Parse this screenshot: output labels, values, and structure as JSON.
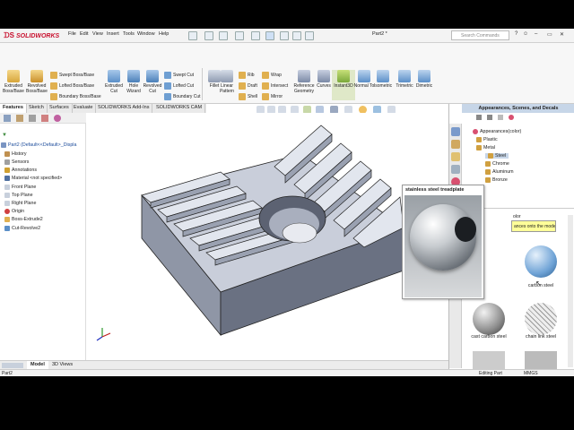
{
  "app": {
    "brand": "SOLIDWORKS",
    "document_title": "Part2 *",
    "search_placeholder": "Search Commands"
  },
  "menu": [
    "File",
    "Edit",
    "View",
    "Insert",
    "Tools",
    "Window",
    "Help"
  ],
  "ribbon": {
    "big_buttons": [
      {
        "label": "Extruded Boss/Base",
        "icon": "extrude-icon"
      },
      {
        "label": "Revolved Boss/Base",
        "icon": "revolve-icon"
      },
      {
        "label": "Extruded Cut",
        "icon": "extruded-cut-icon"
      },
      {
        "label": "Hole Wizard",
        "icon": "hole-wizard-icon"
      },
      {
        "label": "Revolved Cut",
        "icon": "revolved-cut-icon"
      },
      {
        "label": "Fillet",
        "icon": "fillet-icon"
      },
      {
        "label": "Linear Pattern",
        "icon": "linear-pattern-icon"
      },
      {
        "label": "Reference Geometry",
        "icon": "reference-geometry-icon"
      },
      {
        "label": "Curves",
        "icon": "curves-icon"
      },
      {
        "label": "Instant3D",
        "icon": "instant3d-icon"
      },
      {
        "label": "Normal To",
        "icon": "normal-to-icon"
      },
      {
        "label": "Isometric",
        "icon": "isometric-icon"
      },
      {
        "label": "Trimetric",
        "icon": "trimetric-icon"
      },
      {
        "label": "Dimetric",
        "icon": "dimetric-icon"
      }
    ],
    "small_boss": [
      "Swept Boss/Base",
      "Lofted Boss/Base",
      "Boundary Boss/Base"
    ],
    "small_cut": [
      "Swept Cut",
      "Lofted Cut",
      "Boundary Cut"
    ],
    "small_features": [
      "Rib",
      "Draft",
      "Shell"
    ],
    "small_features2": [
      "Wrap",
      "Intersect",
      "Mirror"
    ]
  },
  "tabs": [
    "Features",
    "Sketch",
    "Surfaces",
    "Evaluate",
    "SOLIDWORKS Add-Ins",
    "SOLIDWORKS CAM"
  ],
  "feature_tree": {
    "root": "Part2  (Default<<Default>_Displa",
    "items": [
      "History",
      "Sensors",
      "Annotations",
      "Material <not specified>",
      "Front Plane",
      "Top Plane",
      "Right Plane",
      "Origin",
      "Boss-Extrude2",
      "Cut-Revolve2"
    ]
  },
  "task_pane": {
    "header": "Appearances, Scenes, and Decals",
    "tree": [
      "Appearances(color)",
      "Plastic",
      "Metal",
      "Steel",
      "Chrome",
      "Aluminum",
      "Bronze"
    ],
    "color_label": "olor",
    "tooltip": "ances onto the model",
    "thumbnails": [
      "carbon steel",
      "cast carbon steel",
      "chain link steel"
    ]
  },
  "popup": {
    "title": "stainless steel treadplate"
  },
  "bottom_tabs": [
    "Model",
    "3D Views"
  ],
  "status": {
    "left": "Part2",
    "center": "Editing Part",
    "units": "MMGS"
  },
  "colors": {
    "brand_red": "#c8102e",
    "part_face": "#c5cad6",
    "part_dark": "#7d8494",
    "selection_blue": "#c7d6e8"
  }
}
